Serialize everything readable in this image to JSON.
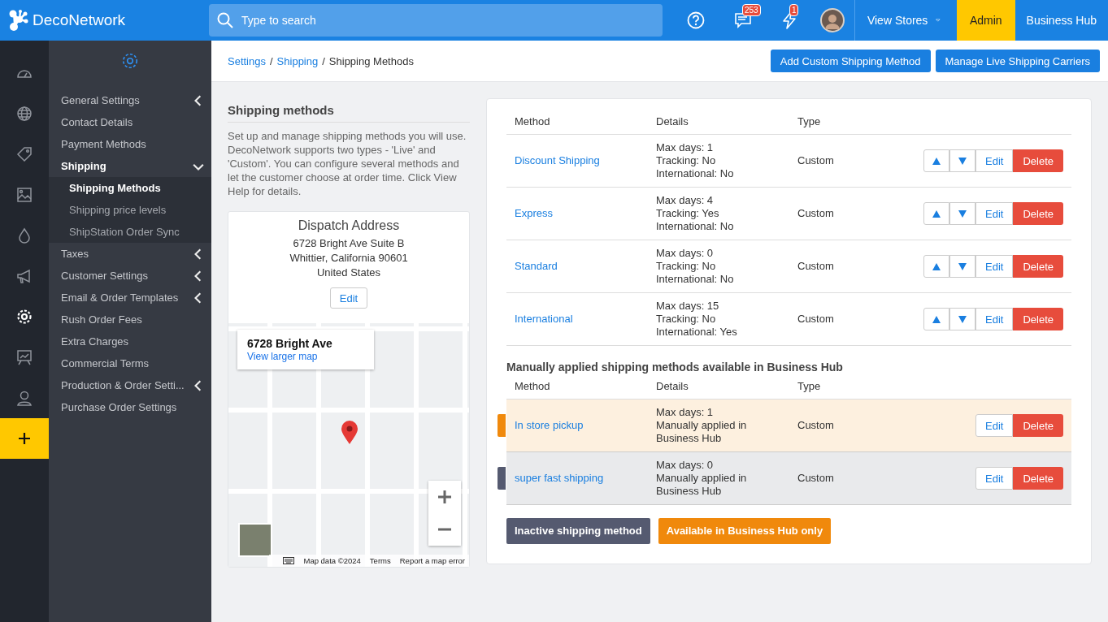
{
  "topbar": {
    "logo": "DecoNetwork",
    "search_placeholder": "Type to search",
    "messages_badge": "253",
    "alerts_badge": "1",
    "view_stores": "View Stores",
    "nav": [
      {
        "label": "Admin",
        "selected": true
      },
      {
        "label": "Business Hub",
        "selected": false
      }
    ]
  },
  "rail": [
    {
      "kind": "dashboard",
      "selected": false
    },
    {
      "kind": "globe",
      "selected": false
    },
    {
      "kind": "tag",
      "selected": false
    },
    {
      "kind": "image",
      "selected": false
    },
    {
      "kind": "drop",
      "selected": false
    },
    {
      "kind": "megaphone",
      "selected": false
    },
    {
      "kind": "gear",
      "selected": true
    },
    {
      "kind": "presentation",
      "selected": false
    },
    {
      "kind": "user",
      "selected": false
    }
  ],
  "sidebar": {
    "items": [
      {
        "label": "General Settings",
        "selected": false,
        "expandable": true,
        "expanded": false
      },
      {
        "label": "Contact Details",
        "selected": false,
        "expandable": false,
        "expanded": false
      },
      {
        "label": "Payment Methods",
        "selected": false,
        "expandable": false,
        "expanded": false
      },
      {
        "label": "Shipping",
        "selected": true,
        "expandable": true,
        "expanded": true,
        "children": [
          {
            "label": "Shipping Methods",
            "selected": true
          },
          {
            "label": "Shipping price levels",
            "selected": false
          },
          {
            "label": "ShipStation Order Sync",
            "selected": false
          }
        ]
      },
      {
        "label": "Taxes",
        "selected": false,
        "expandable": true,
        "expanded": false
      },
      {
        "label": "Customer Settings",
        "selected": false,
        "expandable": true,
        "expanded": false
      },
      {
        "label": "Email & Order Templates",
        "selected": false,
        "expandable": true,
        "expanded": false
      },
      {
        "label": "Rush Order Fees",
        "selected": false,
        "expandable": false,
        "expanded": false
      },
      {
        "label": "Extra Charges",
        "selected": false,
        "expandable": false,
        "expanded": false
      },
      {
        "label": "Commercial Terms",
        "selected": false,
        "expandable": false,
        "expanded": false
      },
      {
        "label": "Production & Order Setti...",
        "selected": false,
        "expandable": true,
        "expanded": false
      },
      {
        "label": "Purchase Order Settings",
        "selected": false,
        "expandable": false,
        "expanded": false
      }
    ]
  },
  "breadcrumb": {
    "items": [
      "Settings",
      "Shipping",
      "Shipping Methods"
    ],
    "separator": "/"
  },
  "header_buttons": [
    "Add Custom Shipping Method",
    "Manage Live Shipping Carriers"
  ],
  "intro": {
    "title": "Shipping methods",
    "text": "Set up and manage shipping methods you will use. DecoNetwork supports two types - 'Live' and 'Custom'. You can configure several methods and let the customer choose at order time. Click View Help for details."
  },
  "dispatch": {
    "title": "Dispatch Address",
    "lines": [
      "6728 Bright Ave Suite B",
      "Whittier, California 90601",
      "United States"
    ],
    "edit": "Edit"
  },
  "map": {
    "info_title": "6728 Bright Ave",
    "info_link": "View larger map",
    "footer": [
      "Map data ©2024",
      "Terms",
      "Report a map error"
    ]
  },
  "methods_table": {
    "columns": [
      "Method",
      "Details",
      "Type"
    ],
    "rows": [
      {
        "name": "Discount Shipping",
        "details": [
          "Max days: 1",
          "Tracking: No",
          "International: No"
        ],
        "type": "Custom",
        "reorder": true,
        "actions": [
          "Edit",
          "Delete"
        ]
      },
      {
        "name": "Express",
        "details": [
          "Max days: 4",
          "Tracking: Yes",
          "International: No"
        ],
        "type": "Custom",
        "reorder": true,
        "actions": [
          "Edit",
          "Delete"
        ]
      },
      {
        "name": "Standard",
        "details": [
          "Max days: 0",
          "Tracking: No",
          "International: No"
        ],
        "type": "Custom",
        "reorder": true,
        "actions": [
          "Edit",
          "Delete"
        ]
      },
      {
        "name": "International",
        "details": [
          "Max days: 15",
          "Tracking: No",
          "International: Yes"
        ],
        "type": "Custom",
        "reorder": true,
        "actions": [
          "Edit",
          "Delete"
        ]
      }
    ]
  },
  "manual_table": {
    "title": "Manually applied shipping methods available in Business Hub",
    "columns": [
      "Method",
      "Details",
      "Type"
    ],
    "rows": [
      {
        "name": "In store pickup",
        "details": [
          "Max days: 1",
          "Manually applied in Business Hub"
        ],
        "type": "Custom",
        "color": "#f0890c",
        "reorder": false,
        "actions": [
          "Edit",
          "Delete"
        ]
      },
      {
        "name": "super fast shipping",
        "details": [
          "Max days: 0",
          "Manually applied in Business Hub"
        ],
        "type": "Custom",
        "color": "#555a70",
        "reorder": false,
        "actions": [
          "Edit",
          "Delete"
        ]
      }
    ]
  },
  "legend": [
    {
      "label": "Inactive shipping method",
      "color": "#555a70"
    },
    {
      "label": "Available in Business Hub only",
      "color": "#f0890c"
    }
  ]
}
